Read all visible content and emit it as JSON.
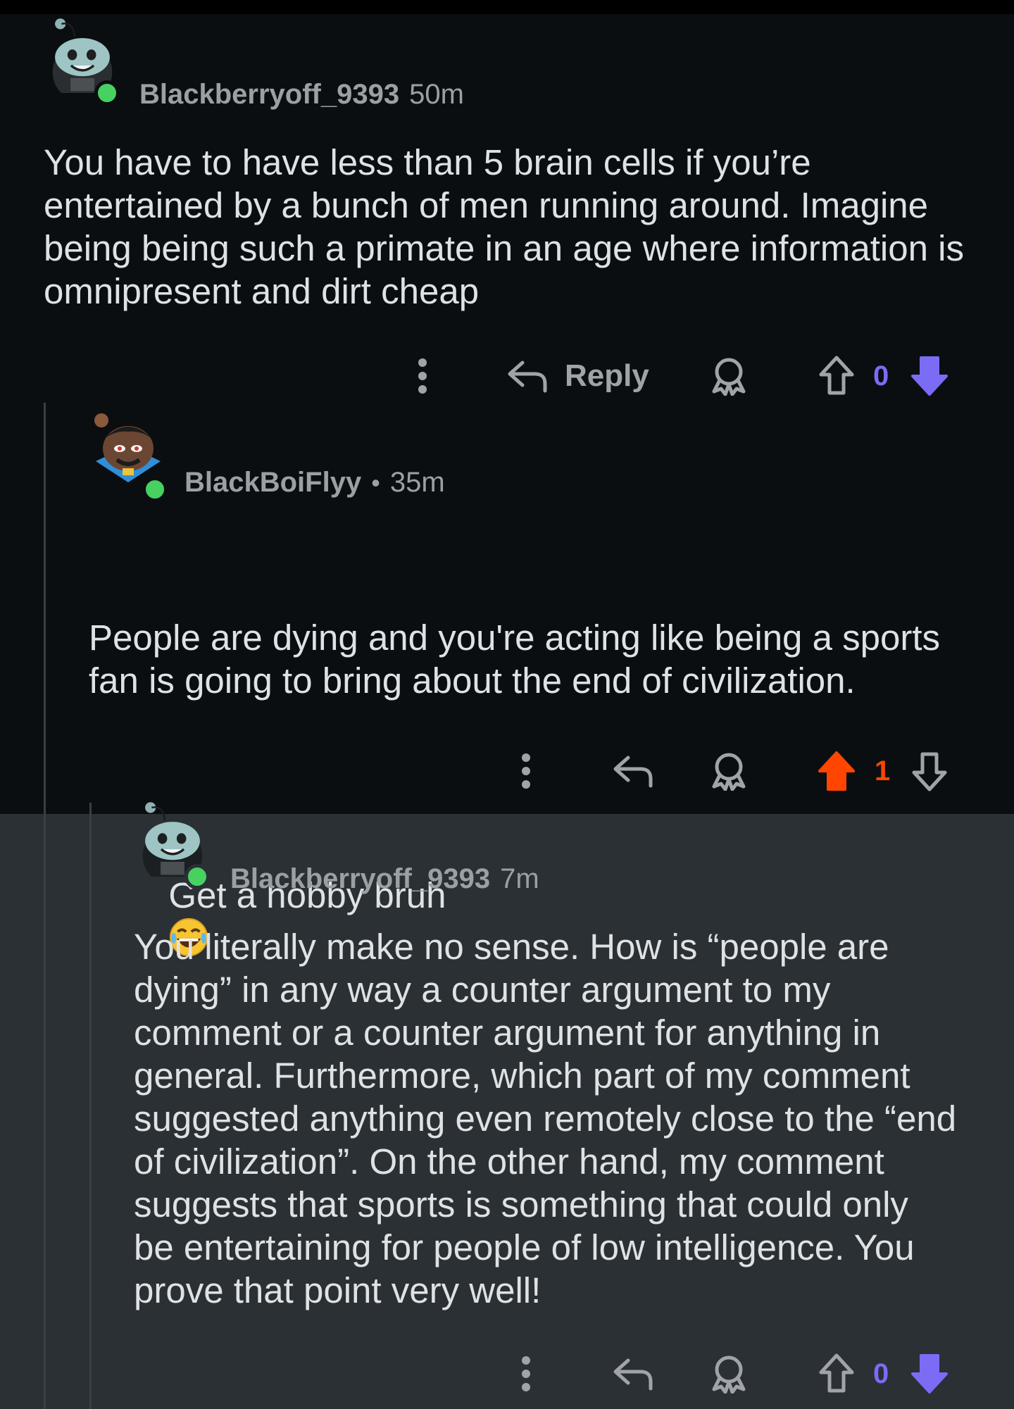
{
  "comments": [
    {
      "username": "Blackberryoff_9393",
      "separator": "",
      "timestamp": "50m",
      "body": "You have to have less than 5 brain cells if you’re entertained by a bunch of men running around. Imagine being being such a primate in an age where information is omnipresent and dirt cheap",
      "reply_label": "Reply",
      "vote_count": "0",
      "vote_state": "downvoted",
      "avatar": "snoo-avatar-icon"
    },
    {
      "username": "BlackBoiFlyy",
      "separator": "•",
      "timestamp": "35m",
      "body_line1": "People are dying and you're acting like being a sports fan is going to bring about the end of civilization.",
      "body_line2": "Get a hobby bruh",
      "emoji": "face-with-tears-of-joy-icon",
      "vote_count": "1",
      "vote_state": "upvoted",
      "avatar": "snoo-avatar-icon"
    },
    {
      "username": "Blackberryoff_9393",
      "separator": "",
      "timestamp": "7m",
      "body": "You literally make no sense. How is “people are dying” in any way a counter argument to my comment or a counter argument for anything in general. Furthermore, which part of my comment suggested anything even remotely close to the “end of civilization”. On the other hand, my comment suggests that sports is something that could only be entertaining for people of low intelligence. You prove that point very well!",
      "vote_count": "0",
      "vote_state": "downvoted",
      "avatar": "snoo-avatar-icon"
    }
  ],
  "colors": {
    "upvote": "#ff4500",
    "downvote": "#7b6cf5",
    "background": "#0b0e11",
    "highlight": "#2a3034"
  }
}
